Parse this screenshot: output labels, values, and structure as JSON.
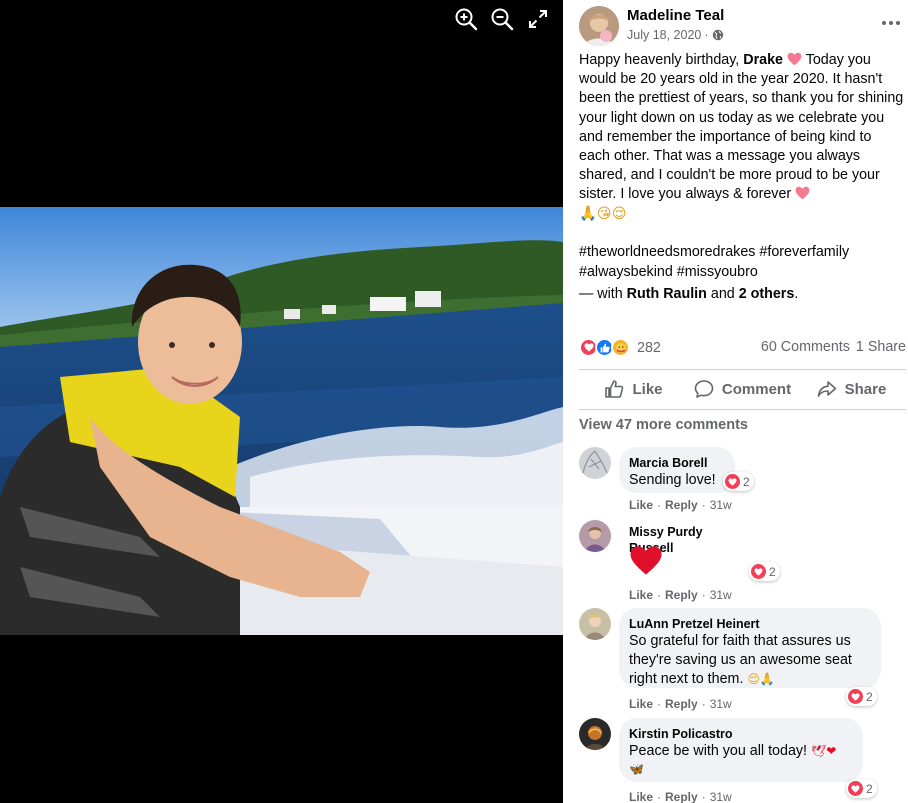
{
  "viewer": {
    "tools": [
      "zoom-in-icon",
      "zoom-out-icon",
      "fullscreen-icon"
    ]
  },
  "post": {
    "author": "Madeline Teal",
    "date": "July 18, 2020",
    "separator": "·",
    "privacy_icon": "globe-icon",
    "text_before": "Happy heavenly birthday, ",
    "mention": "Drake",
    "text_after": " Today you would be 20 years old in the year 2020. It hasn't been the prettiest of years, so thank you for shining your light down on us today as we celebrate you and remember the importance of being kind to each other. That was a message you always shared, and I couldn't be more proud to be your sister. I love you always & forever",
    "emoji_line": "🙏😘😌",
    "hashtags": "#theworldneedsmoredrakes #foreverfamily #alwaysbekind #missyoubro",
    "tagged_prefix": "— with ",
    "tagged_person": "Ruth Raulin",
    "tagged_and": " and ",
    "tagged_others": "2 others",
    "tagged_end": "."
  },
  "stats": {
    "reaction_count": "282",
    "comments": "60 Comments",
    "shares": "1 Share"
  },
  "actions": {
    "like": "Like",
    "comment": "Comment",
    "share": "Share"
  },
  "comments_section": {
    "view_more": "View 47 more comments",
    "items": [
      {
        "name": "Marcia Borell",
        "text": "Sending love!",
        "reactions": "2",
        "like": "Like",
        "reply": "Reply",
        "time": "31w",
        "dot": "·"
      },
      {
        "name": "Missy Purdy Russell",
        "text": "❤",
        "reactions": "2",
        "like": "Like",
        "reply": "Reply",
        "time": "31w",
        "dot": "·"
      },
      {
        "name": "LuAnn Pretzel Heinert",
        "text": "So grateful for faith that assures us they're saving us an awesome seat right next to them.",
        "emoji": "😌🙏",
        "reactions": "2",
        "like": "Like",
        "reply": "Reply",
        "time": "31w",
        "dot": "·"
      },
      {
        "name": "Kirstin Policastro",
        "text": "Peace be with you all today!",
        "emoji": "🕊❤",
        "emoji2": "🦋",
        "reactions": "2",
        "like": "Like",
        "reply": "Reply",
        "time": "31w",
        "dot": "·"
      }
    ]
  },
  "colors": {
    "secondary_text": "#65676b",
    "divider": "#ced0d4",
    "bubble": "#f0f2f5",
    "love": "#f33e58",
    "like": "#1877f2"
  }
}
